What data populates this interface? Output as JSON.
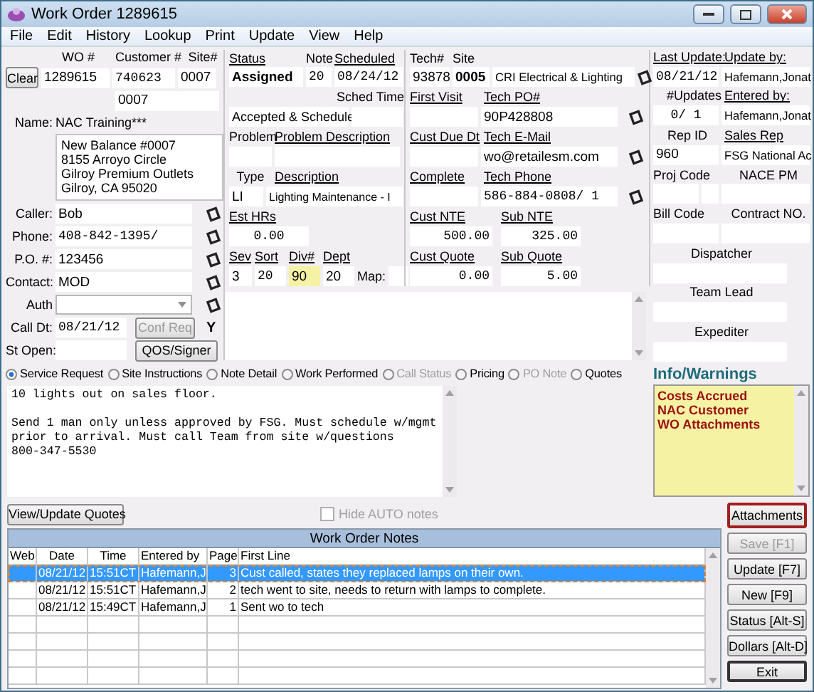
{
  "window": {
    "title": "Work Order 1289615"
  },
  "menu": [
    "File",
    "Edit",
    "History",
    "Lookup",
    "Print",
    "Update",
    "View",
    "Help"
  ],
  "customer": {
    "wo_label": "WO #",
    "customer_label": "Customer #",
    "site_label": "Site#",
    "clear_button": "Clear",
    "wo_number": "1289615",
    "customer_number": "740623",
    "site_number": "0007",
    "site_code": "0007",
    "name_label": "Name:",
    "name": "NAC Training***",
    "address": "New Balance #0007\n8155 Arroyo Circle\nGilroy Premium Outlets\nGilroy, CA 95020"
  },
  "contact_fields": [
    {
      "label": "Caller:",
      "value": "Bob"
    },
    {
      "label": "Phone:",
      "value": "408-842-1395/"
    },
    {
      "label": "P.O. #:",
      "value": "123456"
    },
    {
      "label": "Contact:",
      "value": "MOD"
    }
  ],
  "auth": {
    "label": "Auth"
  },
  "call_date": {
    "label": "Call Dt:",
    "value": "08/21/12",
    "button": "Conf Req",
    "button_disabled": true,
    "flag": "Y"
  },
  "st_open": {
    "label": "St Open:",
    "button": "QOS/Signer"
  },
  "status": {
    "status_label": "Status",
    "status": "Assigned",
    "note_label": "Note",
    "note": "20",
    "scheduled_label": "Scheduled",
    "scheduled": "08/24/12",
    "sched_time_label": "Sched Time",
    "schedule_state": "Accepted & Schedule",
    "problem_label": "Problem",
    "problem_desc_label": "Problem Description",
    "type_label": "Type",
    "type": "LI",
    "description_label": "Description",
    "description": "Lighting Maintenance - I",
    "est_hrs_label": "Est HRs",
    "est_hrs": "0.00",
    "sev_label": "Sev",
    "sev": "3",
    "sort_label": "Sort",
    "sort": "20",
    "div_label": "Div#",
    "div": "90",
    "dept_label": "Dept",
    "dept": "20",
    "map_label": "Map:"
  },
  "tech": {
    "tech_label": "Tech#",
    "site_label": "Site",
    "tech_number": "93878",
    "site": "0005",
    "company": "CRI Electrical & Lighting",
    "first_visit_label": "First Visit",
    "tech_po_label": "Tech PO#",
    "tech_po": "90P428808",
    "cust_due_label": "Cust Due Dt",
    "tech_email_label": "Tech E-Mail",
    "tech_email": "wo@retailesm.com",
    "complete_label": "Complete",
    "tech_phone_label": "Tech Phone",
    "tech_phone": "586-884-0808/ 1",
    "cust_nte_label": "Cust NTE",
    "cust_nte": "500.00",
    "sub_nte_label": "Sub NTE",
    "sub_nte": "325.00",
    "cust_quote_label": "Cust Quote",
    "cust_quote": "0.00",
    "sub_quote_label": "Sub Quote",
    "sub_quote": "5.00"
  },
  "record": {
    "last_update_label": "Last Update:",
    "last_update": "08/21/12",
    "update_by_label": "Update by:",
    "update_by": "Hafemann,Jonat",
    "updates_label": "#Updates",
    "updates": "0/ 1",
    "entered_by_label": "Entered by:",
    "entered_by": "Hafemann,Jonat",
    "rep_id_label": "Rep ID",
    "rep_id": "960",
    "sales_rep_label": "Sales Rep",
    "sales_rep": "FSG National Ac",
    "proj_code_label": "Proj Code",
    "nace_pm_label": "NACE PM",
    "bill_code_label": "Bill Code",
    "contract_label": "Contract NO.",
    "dispatcher_label": "Dispatcher",
    "team_lead_label": "Team Lead",
    "expediter_label": "Expediter"
  },
  "info_warnings": {
    "title": "Info/Warnings",
    "items": [
      "Costs Accrued",
      "NAC Customer",
      "WO Attachments"
    ]
  },
  "note_tabs": [
    {
      "label": "Service Request",
      "selected": true,
      "disabled": false
    },
    {
      "label": "Site Instructions",
      "selected": false,
      "disabled": false
    },
    {
      "label": "Note Detail",
      "selected": false,
      "disabled": false
    },
    {
      "label": "Work Performed",
      "selected": false,
      "disabled": false
    },
    {
      "label": "Call Status",
      "selected": false,
      "disabled": true
    },
    {
      "label": "Pricing",
      "selected": false,
      "disabled": false
    },
    {
      "label": "PO Note",
      "selected": false,
      "disabled": true
    },
    {
      "label": "Quotes",
      "selected": false,
      "disabled": false
    }
  ],
  "note_text": "10 lights out on sales floor.\n\nSend 1 man only unless approved by FSG. Must schedule w/mgmt\nprior to arrival. Must call Team from site w/questions\n800-347-5530",
  "quotes_button": "View/Update Quotes",
  "hide_auto": {
    "label": "Hide AUTO notes",
    "checked": false,
    "disabled": true
  },
  "notes_table": {
    "title": "Work Order Notes",
    "columns": [
      "Web",
      "Date",
      "Time",
      "Entered by",
      "Page",
      "First Line"
    ],
    "rows": [
      {
        "date": "08/21/12",
        "time": "15:51CT",
        "entered_by": "Hafemann,J",
        "page": "3",
        "first_line": "Cust called, states they replaced lamps on their own.",
        "selected": true
      },
      {
        "date": "08/21/12",
        "time": "15:51CT",
        "entered_by": "Hafemann,J",
        "page": "2",
        "first_line": "tech went to site, needs to return with lamps to complete.",
        "selected": false
      },
      {
        "date": "08/21/12",
        "time": "15:49CT",
        "entered_by": "Hafemann,J",
        "page": "1",
        "first_line": "Sent wo to tech",
        "selected": false
      }
    ]
  },
  "actions": [
    {
      "label": "Attachments",
      "disabled": false,
      "focused": true,
      "default": false
    },
    {
      "label": "Save [F1]",
      "disabled": true,
      "focused": false,
      "default": false
    },
    {
      "label": "Update [F7]",
      "disabled": false,
      "focused": false,
      "default": false
    },
    {
      "label": "New [F9]",
      "disabled": false,
      "focused": false,
      "default": false
    },
    {
      "label": "Status [Alt-S]",
      "disabled": false,
      "focused": false,
      "default": false
    },
    {
      "label": "Dollars [Alt-D]",
      "disabled": false,
      "focused": false,
      "default": false
    },
    {
      "label": "Exit",
      "disabled": false,
      "focused": false,
      "default": true
    }
  ]
}
